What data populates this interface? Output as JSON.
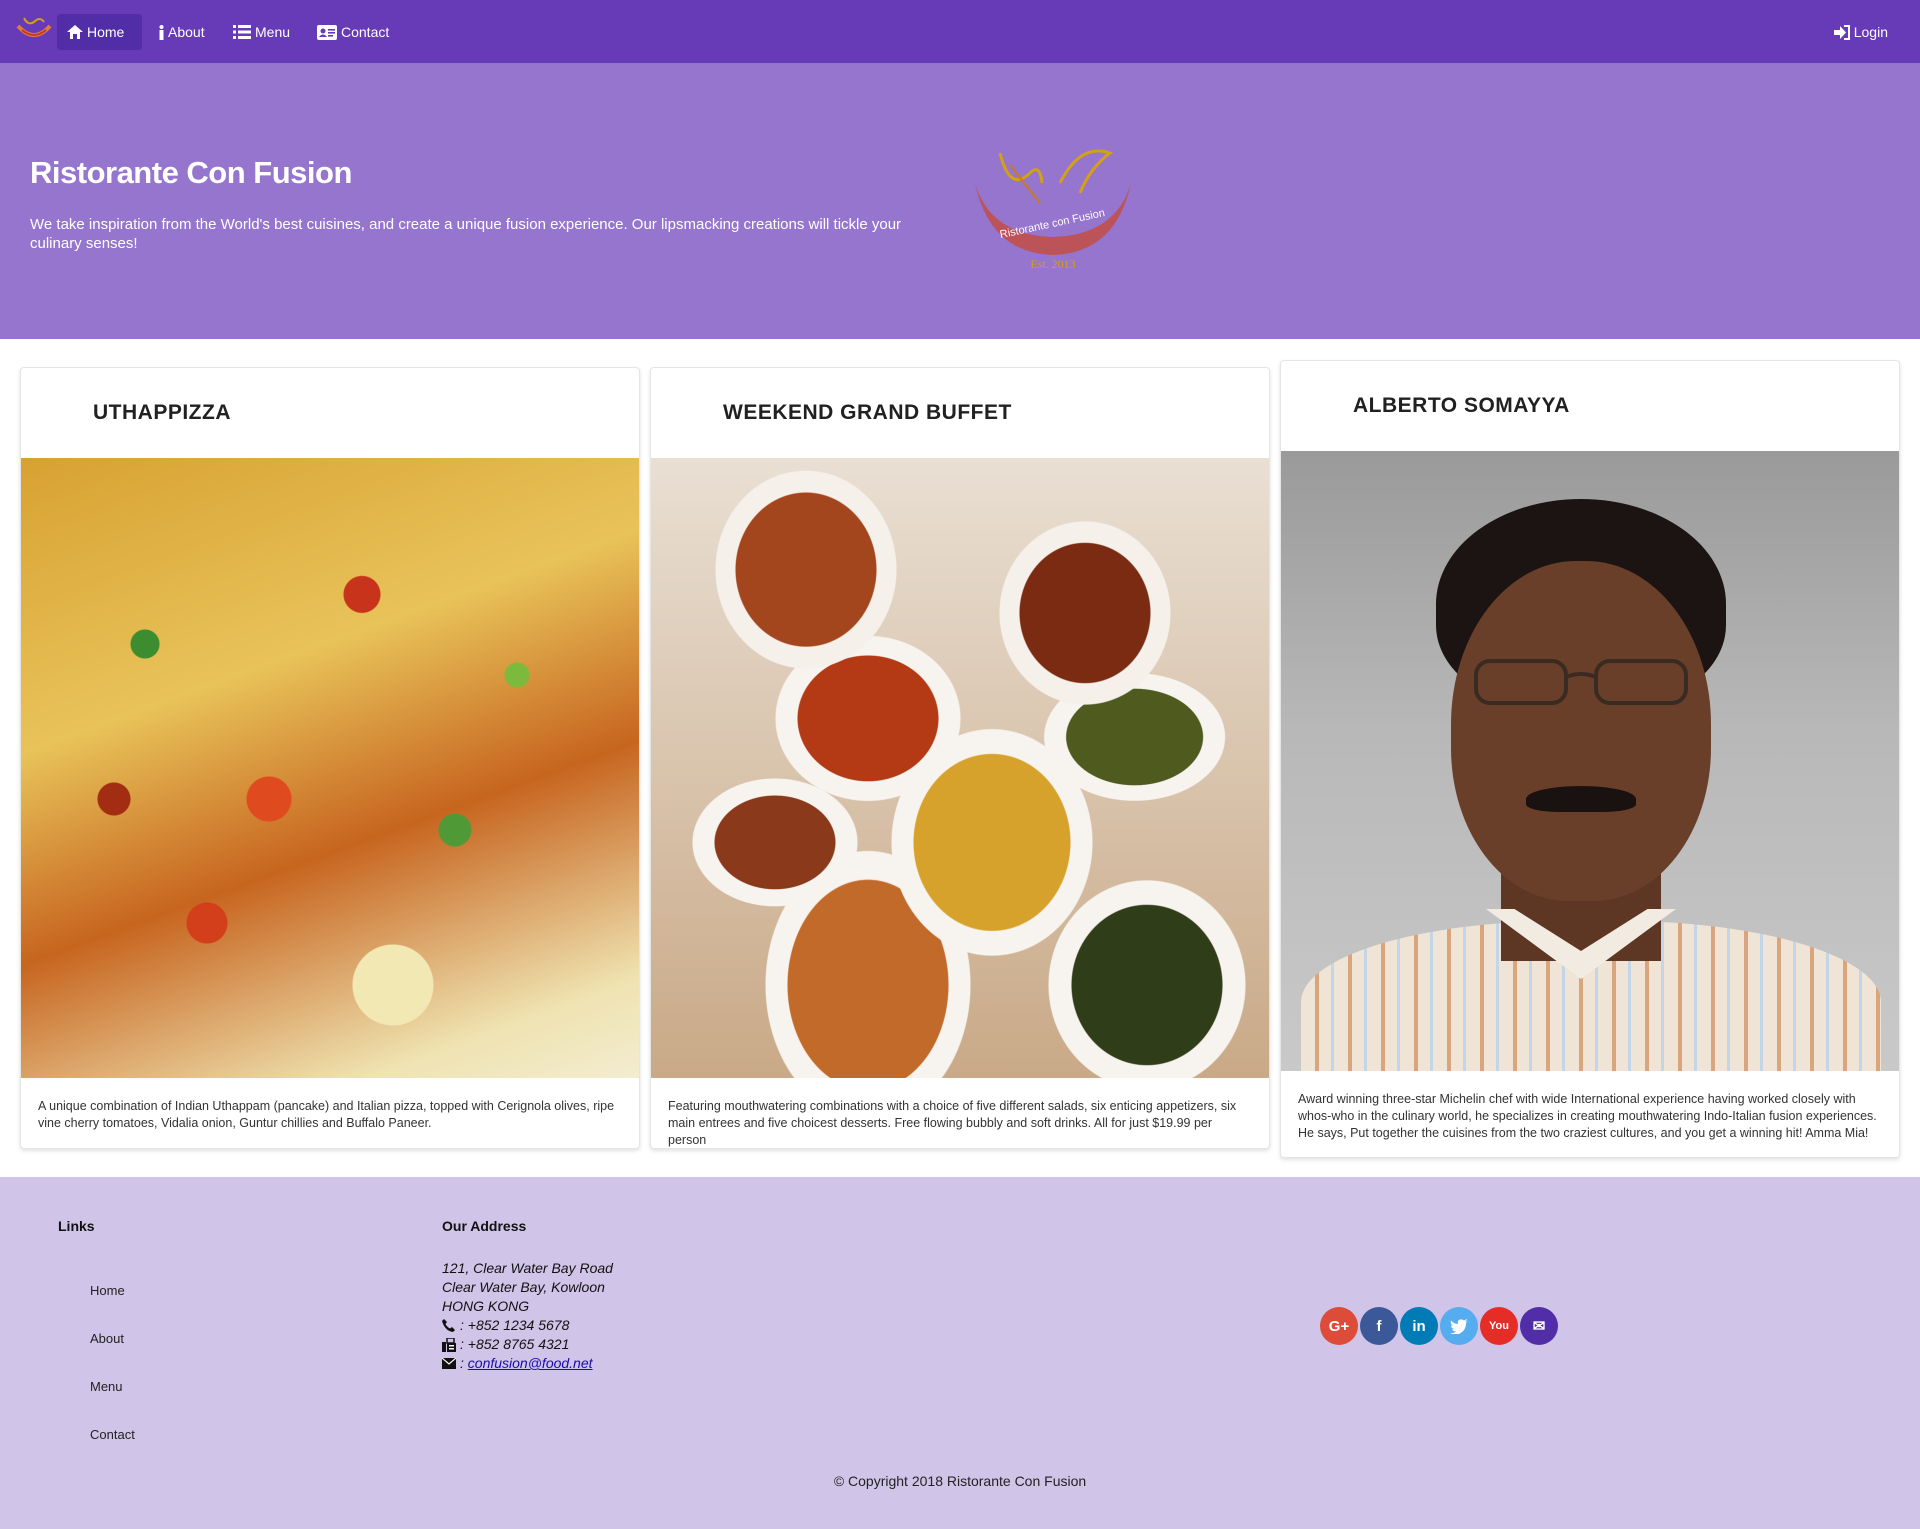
{
  "navbar": {
    "items": [
      {
        "label": "Home",
        "icon": "home-icon",
        "active": true
      },
      {
        "label": "About",
        "icon": "info-icon"
      },
      {
        "label": "Menu",
        "icon": "list-icon"
      },
      {
        "label": "Contact",
        "icon": "address-card-icon"
      }
    ],
    "login_label": "Login",
    "color": "#673ab7",
    "active_color": "#512da8"
  },
  "jumbotron": {
    "title": "Ristorante Con Fusion",
    "text": "We take inspiration from the World's best cuisines, and create a unique fusion experience. Our lipsmacking creations will tickle your culinary senses!",
    "logo_text": "Ristorante con Fusion",
    "logo_est": "Est. 2013",
    "color": "#9575cd"
  },
  "cards": [
    {
      "title": "UTHAPPIZZA",
      "description": "A unique combination of Indian Uthappam (pancake) and Italian pizza, topped with Cerignola olives, ripe vine cherry tomatoes, Vidalia onion, Guntur chillies and Buffalo Paneer."
    },
    {
      "title": "WEEKEND GRAND BUFFET",
      "description": "Featuring mouthwatering combinations with a choice of five different salads, six enticing appetizers, six main entrees and five choicest desserts. Free flowing bubbly and soft drinks. All for just $19.99 per person"
    },
    {
      "title": "ALBERTO SOMAYYA",
      "description": "Award winning three-star Michelin chef with wide International experience having worked closely with whos-who in the culinary world, he specializes in creating mouthwatering Indo-Italian fusion experiences. He says, Put together the cuisines from the two craziest cultures, and you get a winning hit! Amma Mia!"
    }
  ],
  "footer": {
    "links_heading": "Links",
    "links": [
      "Home",
      "About",
      "Menu",
      "Contact"
    ],
    "address_heading": "Our Address",
    "address_lines": [
      "121, Clear Water Bay Road",
      "Clear Water Bay, Kowloon",
      "HONG KONG"
    ],
    "phone": ": +852 1234 5678",
    "fax": ": +852 8765 4321",
    "email": "confusion@food.net",
    "social": [
      {
        "name": "google-plus-icon",
        "glyph": "G+",
        "color": "#dd4b39"
      },
      {
        "name": "facebook-icon",
        "glyph": "f",
        "color": "#3b5998"
      },
      {
        "name": "linkedin-icon",
        "glyph": "in",
        "color": "#007bb6"
      },
      {
        "name": "twitter-icon",
        "glyph": "t",
        "color": "#55acee"
      },
      {
        "name": "youtube-icon",
        "glyph": "You",
        "color": "#e52d27"
      },
      {
        "name": "mail-icon",
        "glyph": "✉",
        "color": "#512da8"
      }
    ],
    "copyright": "© Copyright 2018 Ristorante Con Fusion",
    "color": "#d1c4e9"
  }
}
